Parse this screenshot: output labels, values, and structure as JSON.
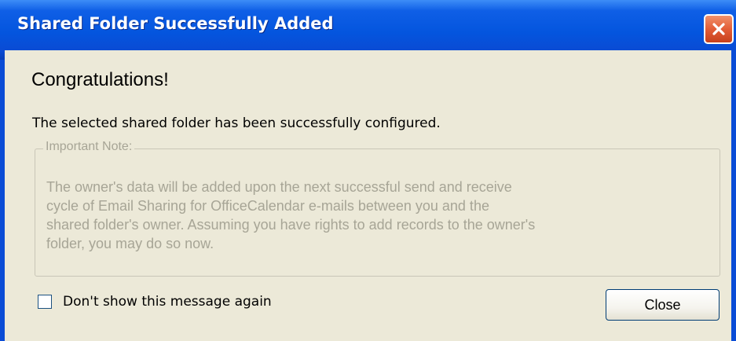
{
  "window": {
    "title": "Shared Folder Successfully Added",
    "close_icon": "close-x-icon"
  },
  "content": {
    "heading": "Congratulations!",
    "message": "The selected shared folder has been successfully configured."
  },
  "note": {
    "label": "Important Note:",
    "lines": [
      "The owner's data will be added upon the next successful send and receive",
      "cycle of Email Sharing for OfficeCalendar e-mails between you and the",
      "shared folder's owner. Assuming you have rights to add records to the owner's",
      "folder, you may do so now."
    ]
  },
  "footer": {
    "checkbox_label": "Don't show this message again",
    "checkbox_checked": false,
    "close_label": "Close"
  },
  "colors": {
    "title_bar": "#0455de",
    "dialog_background": "#ece9d8",
    "close_x": "#e35d37",
    "disabled_text": "#a7a596"
  }
}
